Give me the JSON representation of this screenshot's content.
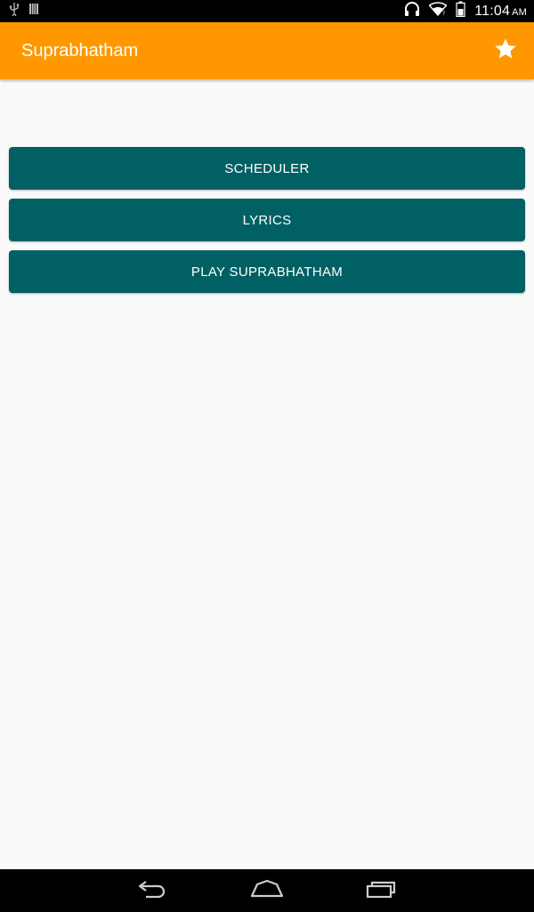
{
  "status_bar": {
    "time": "11:04",
    "ampm": "AM",
    "icons": [
      "usb-icon",
      "storage-icon",
      "headset-icon",
      "wifi-icon",
      "battery-icon"
    ]
  },
  "app_bar": {
    "title": "Suprabhatham",
    "color": "#ff9800",
    "action_icon": "star-icon"
  },
  "main": {
    "buttons": [
      {
        "label": "SCHEDULER"
      },
      {
        "label": "LYRICS"
      },
      {
        "label": "PLAY SUPRABHATHAM"
      }
    ],
    "button_color": "#006064"
  },
  "nav_bar": {
    "buttons": [
      "back-icon",
      "home-icon",
      "recent-apps-icon"
    ]
  }
}
